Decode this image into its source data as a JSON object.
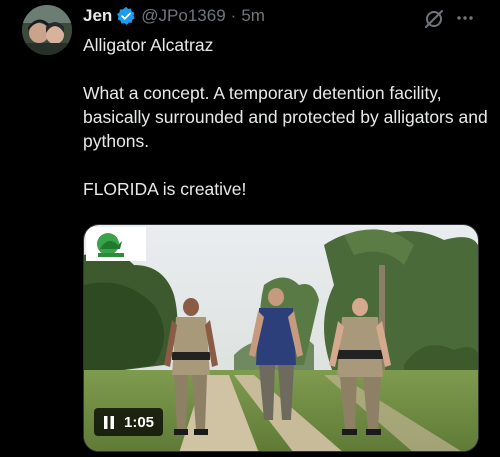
{
  "author": {
    "name": "Jen",
    "handle": "@JPo1369",
    "separator": "·",
    "time": "5m",
    "verified_color": "#1d9bf0"
  },
  "tweet": {
    "line1": "Alligator Alcatraz",
    "line2": "What a concept.  A temporary detention facility, basically surrounded and protected by alligators and pythons.",
    "line3": "FLORIDA is creative!"
  },
  "media": {
    "duration": "1:05",
    "state_icon": "pause-icon",
    "logo_icon": "channel-logo"
  },
  "icons": {
    "grok": "grok-icon",
    "more": "more-icon"
  }
}
